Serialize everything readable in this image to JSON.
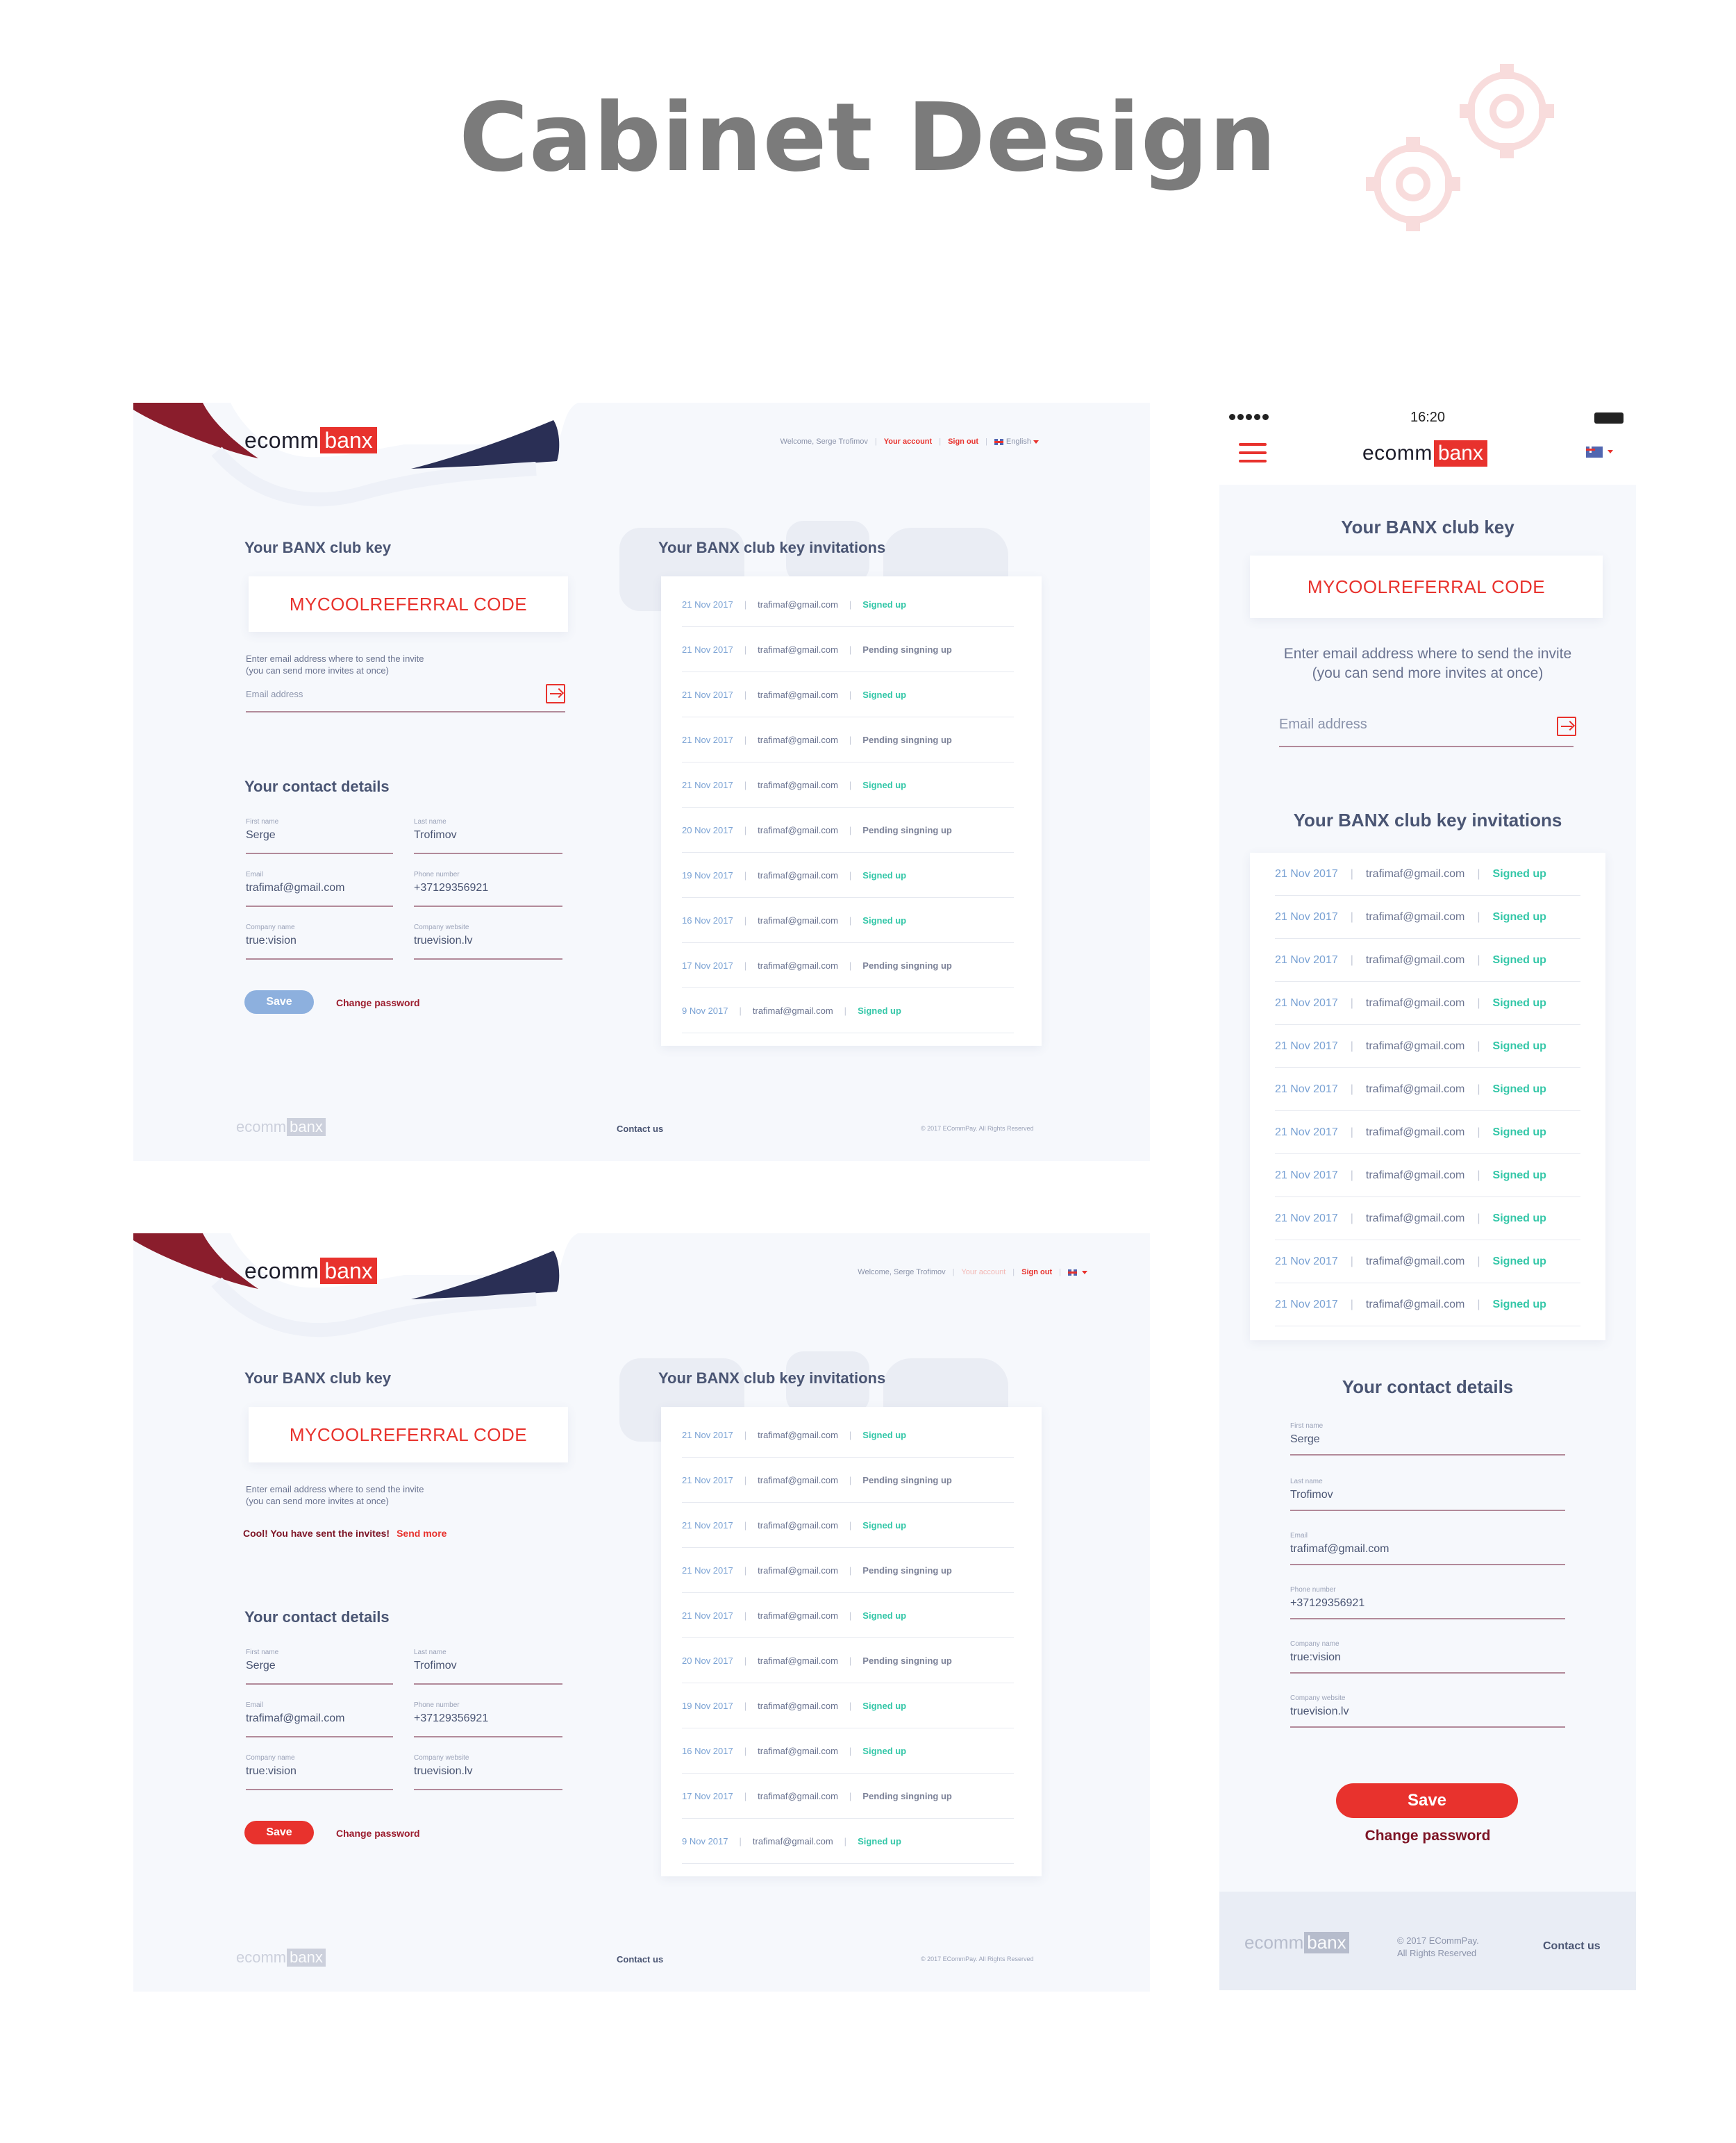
{
  "headline": "Cabinet Design",
  "brand": {
    "left": "ecomm",
    "right": "banx"
  },
  "desktop": {
    "nav": {
      "welcome": "Welcome, Serge Trofimov",
      "account": "Your account",
      "signout": "Sign out",
      "language": "English"
    },
    "club_key_title": "Your BANX club key",
    "code": "MYCOOLREFERRAL CODE",
    "hint_line1": "Enter email address where to send the invite",
    "hint_line2": "(you can send more invites at once)",
    "email_placeholder": "Email address",
    "contact_title": "Your contact details",
    "fields": {
      "first_name": {
        "label": "First name",
        "value": "Serge"
      },
      "last_name": {
        "label": "Last name",
        "value": "Trofimov"
      },
      "email": {
        "label": "Email",
        "value": "trafimaf@gmail.com"
      },
      "phone": {
        "label": "Phone number",
        "value": "+37129356921"
      },
      "company": {
        "label": "Company name",
        "value": "true:vision"
      },
      "website": {
        "label": "Company website",
        "value": "truevision.lv"
      }
    },
    "save_label": "Save",
    "change_password": "Change password",
    "invitations_title": "Your BANX club key invitations",
    "invitations": [
      {
        "date": "21 Nov 2017",
        "email": "trafimaf@gmail.com",
        "status": "Signed up",
        "ok": true
      },
      {
        "date": "21 Nov 2017",
        "email": "trafimaf@gmail.com",
        "status": "Pending singning up",
        "ok": false
      },
      {
        "date": "21 Nov 2017",
        "email": "trafimaf@gmail.com",
        "status": "Signed up",
        "ok": true
      },
      {
        "date": "21 Nov 2017",
        "email": "trafimaf@gmail.com",
        "status": "Pending singning up",
        "ok": false
      },
      {
        "date": "21 Nov 2017",
        "email": "trafimaf@gmail.com",
        "status": "Signed up",
        "ok": true
      },
      {
        "date": "20 Nov 2017",
        "email": "trafimaf@gmail.com",
        "status": "Pending singning up",
        "ok": false
      },
      {
        "date": "19 Nov 2017",
        "email": "trafimaf@gmail.com",
        "status": "Signed up",
        "ok": true
      },
      {
        "date": "16 Nov 2017",
        "email": "trafimaf@gmail.com",
        "status": "Signed up",
        "ok": true
      },
      {
        "date": "17 Nov 2017",
        "email": "trafimaf@gmail.com",
        "status": "Pending singning up",
        "ok": false
      },
      {
        "date": "9 Nov 2017",
        "email": "trafimaf@gmail.com",
        "status": "Signed up",
        "ok": true
      }
    ],
    "footer": {
      "contact": "Contact us",
      "copyright": "© 2017 ECommPay. All Rights Reserved"
    },
    "success_text": "Cool! You have sent the invites!",
    "send_more": "Send more"
  },
  "mobile": {
    "time": "16:20",
    "club_key_title": "Your BANX club key",
    "code": "MYCOOLREFERRAL CODE",
    "hint": "Enter email address where to send the invite (you can send more invites at once)",
    "email_placeholder": "Email address",
    "invitations_title": "Your BANX club key invitations",
    "invitations": [
      {
        "date": "21 Nov 2017",
        "email": "trafimaf@gmail.com",
        "status": "Signed up"
      },
      {
        "date": "21 Nov 2017",
        "email": "trafimaf@gmail.com",
        "status": "Signed up"
      },
      {
        "date": "21 Nov 2017",
        "email": "trafimaf@gmail.com",
        "status": "Signed up"
      },
      {
        "date": "21 Nov 2017",
        "email": "trafimaf@gmail.com",
        "status": "Signed up"
      },
      {
        "date": "21 Nov 2017",
        "email": "trafimaf@gmail.com",
        "status": "Signed up"
      },
      {
        "date": "21 Nov 2017",
        "email": "trafimaf@gmail.com",
        "status": "Signed up"
      },
      {
        "date": "21 Nov 2017",
        "email": "trafimaf@gmail.com",
        "status": "Signed up"
      },
      {
        "date": "21 Nov 2017",
        "email": "trafimaf@gmail.com",
        "status": "Signed up"
      },
      {
        "date": "21 Nov 2017",
        "email": "trafimaf@gmail.com",
        "status": "Signed up"
      },
      {
        "date": "21 Nov 2017",
        "email": "trafimaf@gmail.com",
        "status": "Signed up"
      },
      {
        "date": "21 Nov 2017",
        "email": "trafimaf@gmail.com",
        "status": "Signed up"
      }
    ],
    "contact_title": "Your contact details",
    "save_label": "Save",
    "change_password": "Change password",
    "footer": {
      "copyright_line1": "© 2017 ECommPay.",
      "copyright_line2": "All Rights Reserved",
      "contact": "Contact us"
    }
  }
}
